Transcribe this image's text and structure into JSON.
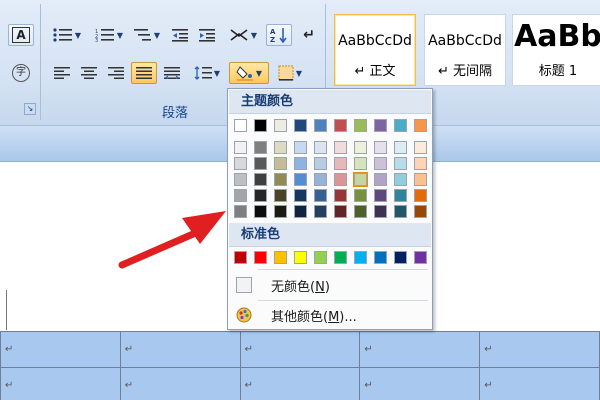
{
  "ribbon": {
    "group_label": "段落",
    "launcher_glyph": "↘",
    "font_buttons": {
      "box_a": "A",
      "circled": "字"
    },
    "styles": [
      {
        "sample": "AaBbCcDd",
        "name": "↵ 正文",
        "active": true
      },
      {
        "sample": "AaBbCcDd",
        "name": "↵ 无间隔",
        "active": false
      },
      {
        "sample": "AaBb",
        "name": "标题 1",
        "active": false
      }
    ]
  },
  "color_popup": {
    "theme_title": "主题颜色",
    "standard_title": "标准色",
    "theme_top_row": [
      "#ffffff",
      "#000000",
      "#eeece1",
      "#1f497d",
      "#4f81bd",
      "#c0504d",
      "#9bbb59",
      "#8064a2",
      "#4bacc6",
      "#f79646"
    ],
    "theme_shades": [
      [
        "#f2f2f2",
        "#d8d8d8",
        "#bfbfbf",
        "#a5a5a5",
        "#7f7f7f"
      ],
      [
        "#7f7f7f",
        "#595959",
        "#3f3f3f",
        "#262626",
        "#0c0c0c"
      ],
      [
        "#ddd9c3",
        "#c4bd97",
        "#938953",
        "#494429",
        "#1d1b10"
      ],
      [
        "#c6d9f0",
        "#8db3e2",
        "#548dd4",
        "#17365d",
        "#0f243e"
      ],
      [
        "#dbe5f1",
        "#b8cce4",
        "#95b3d7",
        "#366092",
        "#244061"
      ],
      [
        "#f2dcdb",
        "#e5b9b7",
        "#d99694",
        "#953734",
        "#632423"
      ],
      [
        "#ebf1dd",
        "#d7e3bc",
        "#c3d69b",
        "#76923c",
        "#4f6128"
      ],
      [
        "#e5e0ec",
        "#ccc1d9",
        "#b2a2c7",
        "#5f497a",
        "#3f3151"
      ],
      [
        "#dbeef3",
        "#b7dde8",
        "#92cddc",
        "#31859b",
        "#205867"
      ],
      [
        "#fdeada",
        "#fbd5b5",
        "#fac08f",
        "#e36c09",
        "#974806"
      ]
    ],
    "selected_swatch": {
      "column": 6,
      "row": 2
    },
    "standard_colors": [
      "#c00000",
      "#ff0000",
      "#ffc000",
      "#ffff00",
      "#92d050",
      "#00b050",
      "#00b0f0",
      "#0070c0",
      "#002060",
      "#7030a0"
    ],
    "no_color": {
      "text": "无颜色(",
      "key": "N",
      "suffix": ")"
    },
    "more_colors": {
      "text": "其他颜色(",
      "key": "M",
      "suffix": ")..."
    }
  },
  "document": {
    "cell_mark": "↵",
    "table_rows": 2,
    "table_cols": 5
  },
  "annotation": {
    "arrow_color": "#e02020"
  }
}
